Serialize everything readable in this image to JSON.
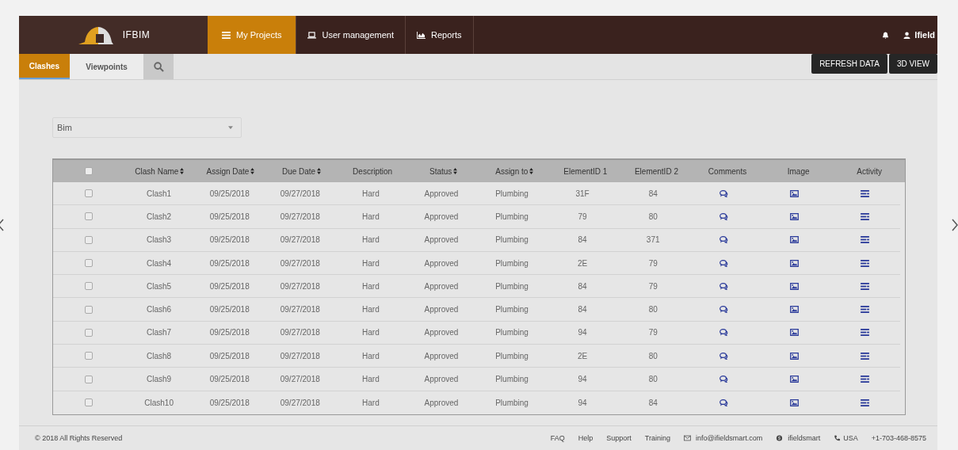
{
  "header": {
    "brand": "IFBIM",
    "nav": [
      {
        "label": "My Projects",
        "selected": true
      },
      {
        "label": "User management",
        "selected": false
      },
      {
        "label": "Reports",
        "selected": false
      }
    ],
    "user": "Ifield"
  },
  "tabs": [
    {
      "label": "Clashes",
      "selected": true
    },
    {
      "label": "Viewpoints",
      "selected": false
    }
  ],
  "actions": [
    "REFRESH DATA",
    "3D VIEW"
  ],
  "project_select": {
    "value": "Bim"
  },
  "table": {
    "select_all_checked": false,
    "columns": [
      {
        "label": "Clash Name",
        "kind": "text",
        "sortable": true
      },
      {
        "label": "Assign Date",
        "kind": "text",
        "sortable": true
      },
      {
        "label": "Due Date",
        "kind": "text",
        "sortable": true
      },
      {
        "label": "Description",
        "kind": "text",
        "sortable": false
      },
      {
        "label": "Status",
        "kind": "text",
        "sortable": true
      },
      {
        "label": "Assign to",
        "kind": "text",
        "sortable": true
      },
      {
        "label": "ElementID 1",
        "kind": "text",
        "sortable": false
      },
      {
        "label": "ElementID 2",
        "kind": "text",
        "sortable": false
      },
      {
        "label": "Comments",
        "kind": "comments",
        "sortable": false
      },
      {
        "label": "Image",
        "kind": "image",
        "sortable": false
      },
      {
        "label": "Activity",
        "kind": "activity",
        "sortable": false
      }
    ],
    "rows": [
      {
        "checked": false,
        "cells": [
          "Clash1",
          "09/25/2018",
          "09/27/2018",
          "Hard",
          "Approved",
          "Plumbing",
          "31F",
          "84"
        ]
      },
      {
        "checked": false,
        "cells": [
          "Clash2",
          "09/25/2018",
          "09/27/2018",
          "Hard",
          "Approved",
          "Plumbing",
          "79",
          "80"
        ]
      },
      {
        "checked": false,
        "cells": [
          "Clash3",
          "09/25/2018",
          "09/27/2018",
          "Hard",
          "Approved",
          "Plumbing",
          "84",
          "371"
        ]
      },
      {
        "checked": false,
        "cells": [
          "Clash4",
          "09/25/2018",
          "09/27/2018",
          "Hard",
          "Approved",
          "Plumbing",
          "2E",
          "79"
        ]
      },
      {
        "checked": false,
        "cells": [
          "Clash5",
          "09/25/2018",
          "09/27/2018",
          "Hard",
          "Approved",
          "Plumbing",
          "84",
          "79"
        ]
      },
      {
        "checked": false,
        "cells": [
          "Clash6",
          "09/25/2018",
          "09/27/2018",
          "Hard",
          "Approved",
          "Plumbing",
          "84",
          "80"
        ]
      },
      {
        "checked": false,
        "cells": [
          "Clash7",
          "09/25/2018",
          "09/27/2018",
          "Hard",
          "Approved",
          "Plumbing",
          "94",
          "79"
        ]
      },
      {
        "checked": false,
        "cells": [
          "Clash8",
          "09/25/2018",
          "09/27/2018",
          "Hard",
          "Approved",
          "Plumbing",
          "2E",
          "80"
        ]
      },
      {
        "checked": false,
        "cells": [
          "Clash9",
          "09/25/2018",
          "09/27/2018",
          "Hard",
          "Approved",
          "Plumbing",
          "94",
          "80"
        ]
      },
      {
        "checked": false,
        "cells": [
          "Clash10",
          "09/25/2018",
          "09/27/2018",
          "Hard",
          "Approved",
          "Plumbing",
          "94",
          "84"
        ]
      }
    ]
  },
  "footer": {
    "copyright": "© 2018 All Rights Reserved",
    "links": [
      "FAQ",
      "Help",
      "Support",
      "Training"
    ],
    "email": "info@ifieldsmart.com",
    "skype": "ifieldsmart",
    "country": "USA",
    "phone": "+1-703-468-8575"
  }
}
